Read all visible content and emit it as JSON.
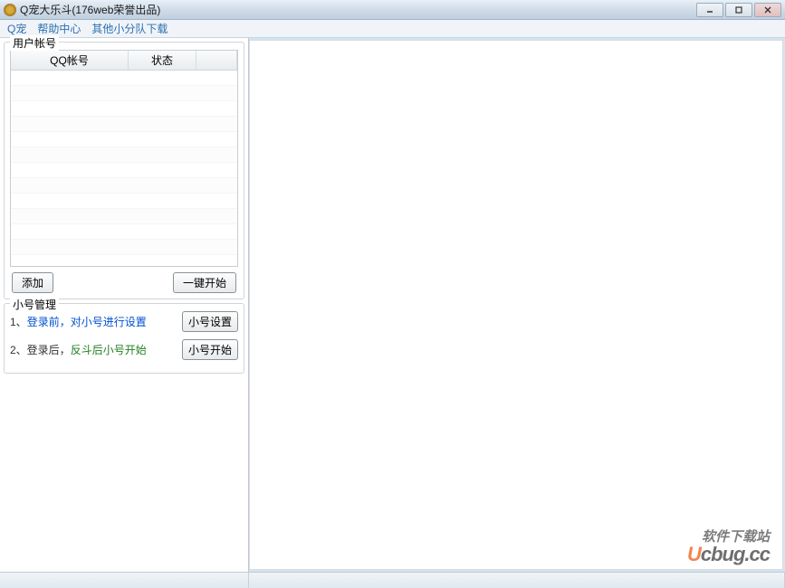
{
  "titlebar": {
    "title": "Q宠大乐斗(176web荣誉出品)"
  },
  "menu": {
    "items": [
      "Q宠",
      "帮助中心",
      "其他小分队下载"
    ]
  },
  "accounts": {
    "group_title": "用户帐号",
    "col_account": "QQ帐号",
    "col_status": "状态",
    "add_btn": "添加",
    "start_btn": "一键开始"
  },
  "mgmt": {
    "group_title": "小号管理",
    "row1_prefix": "1、",
    "row1_blue": "登录前，对小号进行设置",
    "row1_btn": "小号设置",
    "row2_prefix": "2、登录后，",
    "row2_green": "反斗后小号开始",
    "row2_btn": "小号开始"
  },
  "watermark": {
    "line1": "软件下载站",
    "line2_u": "U",
    "line2_rest": "cbug.cc"
  }
}
